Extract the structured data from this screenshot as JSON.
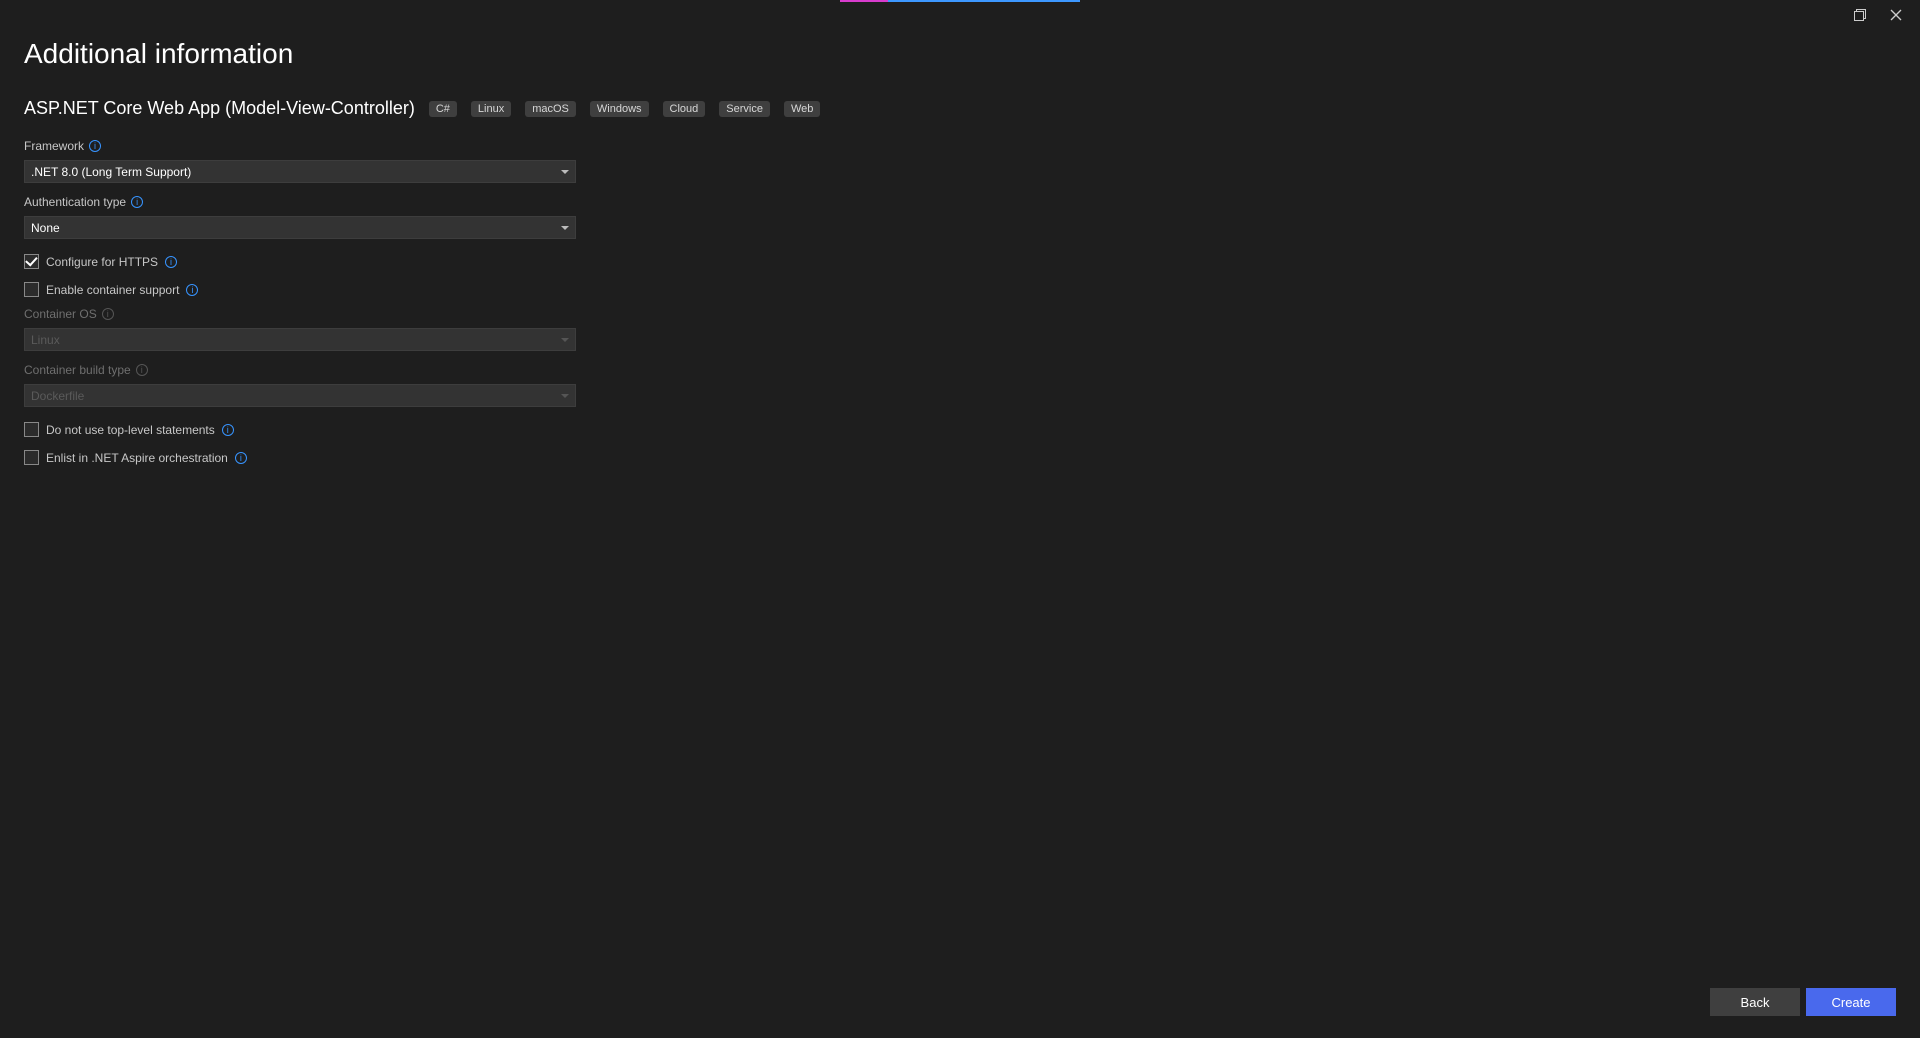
{
  "page_title": "Additional information",
  "template_name": "ASP.NET Core Web App (Model-View-Controller)",
  "tags": [
    "C#",
    "Linux",
    "macOS",
    "Windows",
    "Cloud",
    "Service",
    "Web"
  ],
  "labels": {
    "framework": "Framework",
    "auth_type": "Authentication type",
    "configure_https": "Configure for HTTPS",
    "container_support": "Enable container support",
    "container_os": "Container OS",
    "container_build_type": "Container build type",
    "top_level": "Do not use top-level statements",
    "aspire": "Enlist in .NET Aspire orchestration"
  },
  "values": {
    "framework": ".NET 8.0 (Long Term Support)",
    "auth_type": "None",
    "container_os": "Linux",
    "container_build_type": "Dockerfile"
  },
  "checkboxes": {
    "configure_https": true,
    "container_support": false,
    "top_level": false,
    "aspire": false
  },
  "buttons": {
    "back": "Back",
    "create": "Create"
  }
}
